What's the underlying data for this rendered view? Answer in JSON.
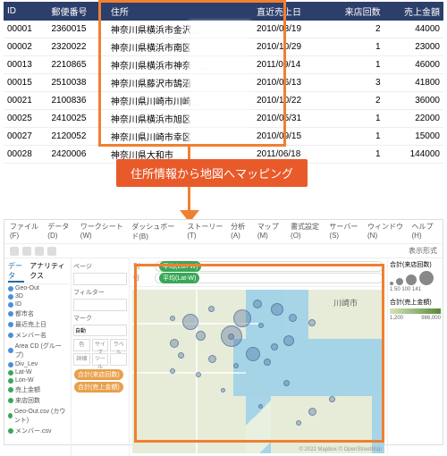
{
  "table": {
    "headers": [
      "ID",
      "郵便番号",
      "住所",
      "直近売上日",
      "来店回数",
      "売上金額"
    ],
    "rows": [
      {
        "id": "00001",
        "zip": "2360015",
        "addr": "神奈川県横浜市金沢区",
        "date": "2010/03/19",
        "visits": "2",
        "amount": "44000"
      },
      {
        "id": "00002",
        "zip": "2320022",
        "addr": "神奈川県横浜市南区",
        "date": "2010/10/29",
        "visits": "1",
        "amount": "23000"
      },
      {
        "id": "00013",
        "zip": "2210865",
        "addr": "神奈川県横浜市神奈川区",
        "date": "2011/09/14",
        "visits": "1",
        "amount": "46000"
      },
      {
        "id": "00015",
        "zip": "2510038",
        "addr": "神奈川県藤沢市鵠沼",
        "date": "2010/06/13",
        "visits": "3",
        "amount": "41800"
      },
      {
        "id": "00021",
        "zip": "2100836",
        "addr": "神奈川県川崎市川崎区",
        "date": "2010/10/22",
        "visits": "2",
        "amount": "36000"
      },
      {
        "id": "00025",
        "zip": "2410025",
        "addr": "神奈川県横浜市旭区",
        "date": "2010/05/31",
        "visits": "1",
        "amount": "22000"
      },
      {
        "id": "00027",
        "zip": "2120052",
        "addr": "神奈川県川崎市幸区",
        "date": "2010/09/15",
        "visits": "1",
        "amount": "15000"
      },
      {
        "id": "00028",
        "zip": "2420006",
        "addr": "神奈川県大和市",
        "date": "2011/06/18",
        "visits": "1",
        "amount": "144000"
      }
    ]
  },
  "callout": "住所情報から地図へマッピング",
  "tableau": {
    "menu": [
      "ファイル(F)",
      "データ(D)",
      "ワークシート(W)",
      "ダッシュボード(B)",
      "ストーリー(T)",
      "分析(A)",
      "マップ(M)",
      "書式設定(O)",
      "サーバー(S)",
      "ウィンドウ(N)",
      "ヘルプ(H)"
    ],
    "showme": "表示形式",
    "tabs": {
      "data": "データ",
      "analytics": "アナリティクス"
    },
    "datasource": "Geo-Out",
    "fields": [
      "3D",
      "ID",
      "都市名",
      "最近売上日",
      "メンバー名",
      "Area CD (グループ)",
      "Div_Lev",
      "Lat-W",
      "Lon-W",
      "売上金額",
      "来店回数",
      "Geo-Out.csv (カウント)",
      "メンバー.csv"
    ],
    "shelves": {
      "pages": "ページ",
      "filters": "フィルター",
      "marks": "マーク",
      "auto": "自動",
      "columns": "列",
      "rows": "行"
    },
    "pills": {
      "lon": "平均(Lon-W)",
      "lat": "平均(Lat-W)",
      "sum_visits": "合計(来店回数)",
      "sum_amount": "合計(売上金額)"
    },
    "legend": {
      "visits_title": "合計(来店回数)",
      "visits_labels": [
        "1",
        "50",
        "100",
        "141"
      ],
      "amount_title": "合計(売上金額)",
      "amount_min": "1,200",
      "amount_max": "986,000"
    },
    "city": "川崎市",
    "attribution": "© 2022 Mapbox © OpenStreetMap"
  }
}
